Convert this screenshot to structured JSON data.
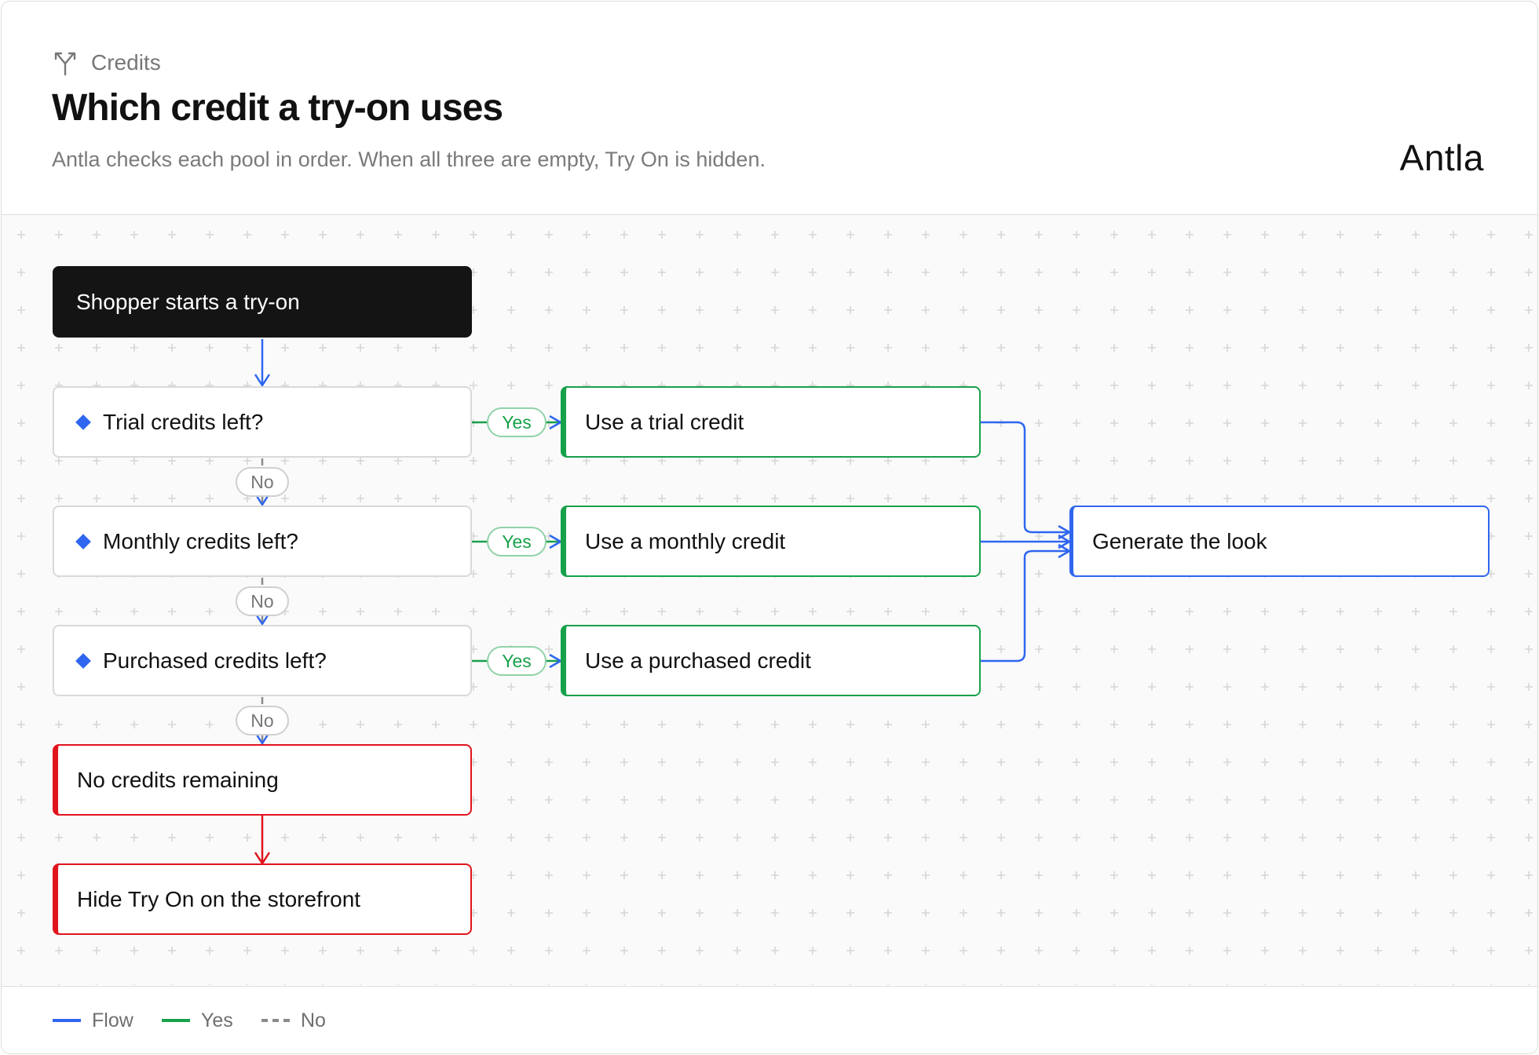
{
  "header": {
    "eyebrow": "Credits",
    "eyebrow_icon": "split-arrows-icon",
    "title": "Which credit a try-on uses",
    "subtitle": "Antla checks each pool in order. When all three are empty, Try On is hidden.",
    "brand": "Antla"
  },
  "flow": {
    "start": "Shopper starts a try-on",
    "questions": [
      "Trial credits left?",
      "Monthly credits left?",
      "Purchased credits left?"
    ],
    "actions": [
      "Use a trial credit",
      "Use a monthly credit",
      "Use a purchased credit"
    ],
    "result": "Generate the look",
    "empty": "No credits remaining",
    "hide": "Hide Try On on the storefront",
    "yes_label": "Yes",
    "no_label": "No"
  },
  "legend": {
    "flow": "Flow",
    "yes": "Yes",
    "no": "No"
  },
  "colors": {
    "flow": "#2f66f0",
    "yes": "#17a14a",
    "no": "#8a8a8a",
    "stop": "#e0141c",
    "start_fill": "#141414"
  }
}
